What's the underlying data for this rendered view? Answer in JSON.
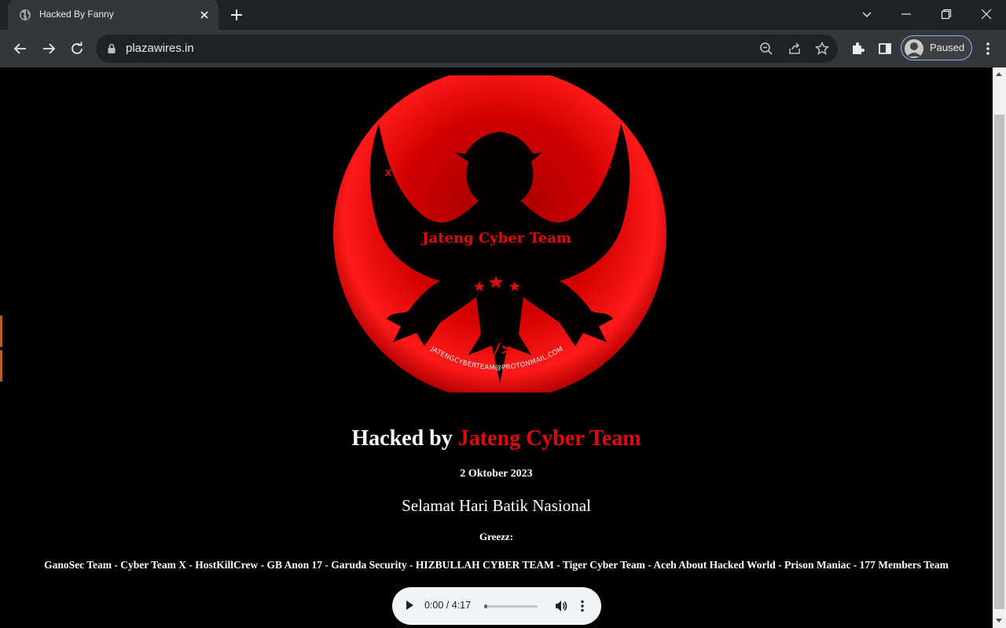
{
  "browser": {
    "tab_title": "Hacked By Fanny",
    "url": "plazawires.in",
    "profile_status": "Paused"
  },
  "page": {
    "emblem": {
      "team_name": "Jateng Cyber Team",
      "email": "JATENGCYBERTEAM@PROTONMAIL.COM",
      "marks": [
        "x",
        "x"
      ],
      "code_symbol": "</>"
    },
    "headline_prefix": "Hacked by",
    "headline_team": "Jateng Cyber Team",
    "date": "2 Oktober 2023",
    "greeting": "Selamat Hari Batik Nasional",
    "greets_label": "Greezz:",
    "teams": "GanoSec Team - Cyber Team X - HostKillCrew - GB Anon 17 - Garuda Security - HIZBULLAH CYBER TEAM - Tiger Cyber Team - Aceh About Hacked World - Prison Maniac - 177 Members Team",
    "audio": {
      "time": "0:00 / 4:17",
      "progress": 0
    }
  },
  "colors": {
    "accent_red": "#e00a0a",
    "moon_red": "#c00000",
    "page_bg": "#000000"
  }
}
